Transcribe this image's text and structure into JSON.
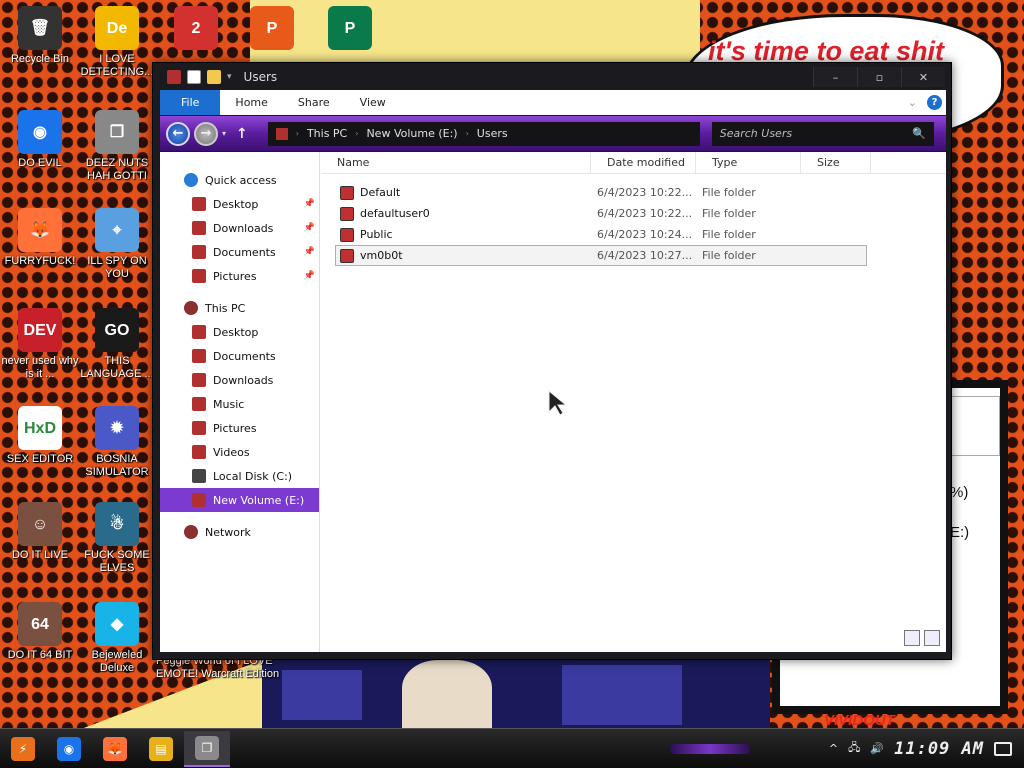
{
  "desktop": {
    "speech_bubble_text": "it's time to eat shit",
    "background_fragments": [
      "%)",
      "E:)"
    ],
    "watermark_text": "VIVIDOUT",
    "icons": [
      {
        "label": "Recycle Bin",
        "icon": "recycle-bin-icon",
        "color": "#333333",
        "glyph": "🗑"
      },
      {
        "label": "I LOVE DETECTING...",
        "icon": "de-icon",
        "color": "#f2b800",
        "glyph": "De"
      },
      {
        "label": "",
        "icon": "number-two-icon",
        "color": "#d33030",
        "glyph": "2"
      },
      {
        "label": "",
        "icon": "p-logo-icon",
        "color": "#e85a1a",
        "glyph": "P"
      },
      {
        "label": "",
        "icon": "publisher-icon",
        "color": "#0a7a4a",
        "glyph": "P"
      },
      {
        "label": "DO EVIL",
        "icon": "chrome-icon",
        "color": "#1a73e8",
        "glyph": "◉"
      },
      {
        "label": "DEEZ NUTS HAH GOTTI",
        "icon": "windows-stack-icon",
        "color": "#888888",
        "glyph": "❐"
      },
      {
        "label": "FURRYFUCK!",
        "icon": "firefox-icon",
        "color": "#ff7139",
        "glyph": "🦊"
      },
      {
        "label": "ILL SPY ON YOU",
        "icon": "network-spy-icon",
        "color": "#5aa0e0",
        "glyph": "⌖"
      },
      {
        "label": "never used why is it ...",
        "icon": "devcpp-icon",
        "color": "#c8202a",
        "glyph": "DEV"
      },
      {
        "label": "THIS LANGUAGE ...",
        "icon": "goland-icon",
        "color": "#1a1a1a",
        "glyph": "GO"
      },
      {
        "label": "SEX EDITOR",
        "icon": "hxd-icon",
        "color": "#ffffff",
        "glyph": "HxD"
      },
      {
        "label": "BOSNIA SIMULATOR",
        "icon": "spiked-ball-icon",
        "color": "#4a58c8",
        "glyph": "✹"
      },
      {
        "label": "DO IT LIVE",
        "icon": "portrait-icon",
        "color": "#7a5040",
        "glyph": "☺"
      },
      {
        "label": "FUCK SOME ELVES",
        "icon": "warcraft-icon",
        "color": "#2a6a8a",
        "glyph": "☃"
      },
      {
        "label": "DO IT 64 BIT",
        "icon": "portrait-64-icon",
        "color": "#7a5040",
        "glyph": "64"
      },
      {
        "label": "Bejeweled Deluxe",
        "icon": "gem-icon",
        "color": "#18b4e8",
        "glyph": "◆"
      },
      {
        "label": "Peggle World of I LOVE EMOTE! Warcraft Edition",
        "icon": "peggle-icon",
        "color": "#e85a1a",
        "glyph": ""
      }
    ]
  },
  "window": {
    "title": "Users",
    "controls": {
      "minimize": "–",
      "maximize": "▫",
      "close": "✕"
    },
    "ribbon": {
      "tabs": [
        "File",
        "Home",
        "Share",
        "View"
      ],
      "expand": "⌄",
      "help": "?"
    },
    "nav": {
      "back": "←",
      "forward": "→",
      "up": "↑",
      "breadcrumb": [
        "This PC",
        "New Volume (E:)",
        "Users"
      ],
      "search_placeholder": "Search Users",
      "search_icon": "🔍"
    },
    "sidebar": [
      {
        "label": "Quick access",
        "type": "group",
        "icon": "star-icon",
        "color": "#2a7ad8"
      },
      {
        "label": "Desktop",
        "type": "item",
        "icon": "folder-icon",
        "color": "#b03030",
        "pinned": true
      },
      {
        "label": "Downloads",
        "type": "item",
        "icon": "folder-icon",
        "color": "#b03030",
        "pinned": true
      },
      {
        "label": "Documents",
        "type": "item",
        "icon": "folder-icon",
        "color": "#b03030",
        "pinned": true
      },
      {
        "label": "Pictures",
        "type": "item",
        "icon": "folder-icon",
        "color": "#b03030",
        "pinned": true
      },
      {
        "label": "This PC",
        "type": "group",
        "icon": "computer-icon",
        "color": "#8a3030"
      },
      {
        "label": "Desktop",
        "type": "item",
        "icon": "folder-icon",
        "color": "#b03030"
      },
      {
        "label": "Documents",
        "type": "item",
        "icon": "folder-icon",
        "color": "#b03030"
      },
      {
        "label": "Downloads",
        "type": "item",
        "icon": "folder-icon",
        "color": "#b03030"
      },
      {
        "label": "Music",
        "type": "item",
        "icon": "folder-icon",
        "color": "#b03030"
      },
      {
        "label": "Pictures",
        "type": "item",
        "icon": "folder-icon",
        "color": "#b03030"
      },
      {
        "label": "Videos",
        "type": "item",
        "icon": "folder-icon",
        "color": "#b03030"
      },
      {
        "label": "Local Disk (C:)",
        "type": "item",
        "icon": "drive-icon",
        "color": "#444444"
      },
      {
        "label": "New Volume (E:)",
        "type": "item",
        "icon": "drive-icon",
        "color": "#b03030",
        "selected": true
      },
      {
        "label": "Network",
        "type": "group",
        "icon": "network-icon",
        "color": "#8a3030"
      }
    ],
    "columns": [
      "Name",
      "Date modified",
      "Type",
      "Size"
    ],
    "files": [
      {
        "name": "Default",
        "date": "6/4/2023 10:22...",
        "type": "File folder",
        "size": ""
      },
      {
        "name": "defaultuser0",
        "date": "6/4/2023 10:22...",
        "type": "File folder",
        "size": ""
      },
      {
        "name": "Public",
        "date": "6/4/2023 10:24...",
        "type": "File folder",
        "size": ""
      },
      {
        "name": "vm0b0t",
        "date": "6/4/2023 10:27...",
        "type": "File folder",
        "size": "",
        "selected": true
      }
    ]
  },
  "taskbar": {
    "items": [
      {
        "icon": "start-icon",
        "color": "#e8701a",
        "glyph": "⚡"
      },
      {
        "icon": "chrome-icon",
        "color": "#1a73e8",
        "glyph": "◉"
      },
      {
        "icon": "firefox-icon",
        "color": "#ff7139",
        "glyph": "🦊"
      },
      {
        "icon": "file-explorer-icon",
        "color": "#e8b01a",
        "glyph": "▤"
      },
      {
        "icon": "window-app-icon",
        "color": "#8a8a8a",
        "glyph": "❐",
        "active": true
      }
    ],
    "tray_chevron": "^",
    "tray_network": "🖧",
    "tray_volume": "🔊",
    "clock": "11:09 AM"
  }
}
